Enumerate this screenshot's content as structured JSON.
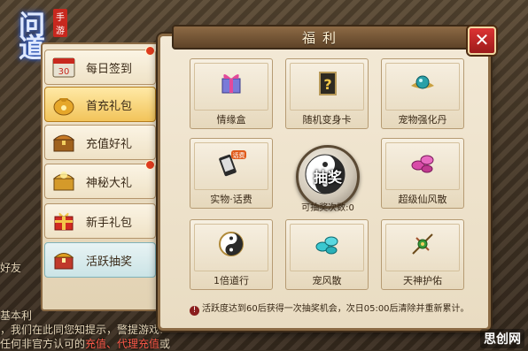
{
  "game_logo": {
    "text": "问道",
    "tag": "手游"
  },
  "dialog": {
    "title": "福利",
    "close_label": "✕"
  },
  "menu": [
    {
      "label": "每日签到",
      "icon": "calendar-icon",
      "badge": true
    },
    {
      "label": "首充礼包",
      "icon": "money-bag-icon",
      "badge": false
    },
    {
      "label": "充值好礼",
      "icon": "treasure-chest-icon",
      "badge": false
    },
    {
      "label": "神秘大礼",
      "icon": "gold-chest-icon",
      "badge": true
    },
    {
      "label": "新手礼包",
      "icon": "gift-box-icon",
      "badge": false
    },
    {
      "label": "活跃抽奖",
      "icon": "lottery-chest-icon",
      "badge": false
    }
  ],
  "rewards": [
    {
      "label": "情缘盒",
      "icon": "ribbon-box-icon"
    },
    {
      "label": "随机变身卡",
      "icon": "mystery-card-icon"
    },
    {
      "label": "宠物强化丹",
      "icon": "orb-icon"
    },
    {
      "label": "实物·话费",
      "icon": "phone-icon",
      "tag": "话费"
    },
    {
      "label": "超级仙风散",
      "icon": "pink-gems-icon"
    },
    {
      "label": "1倍道行",
      "icon": "yin-yang-icon"
    },
    {
      "label": "宠风散",
      "icon": "cyan-gems-icon"
    },
    {
      "label": "天神护佑",
      "icon": "amulet-icon"
    }
  ],
  "lottery": {
    "label": "抽奖",
    "draws_text": "可抽奖次数:0"
  },
  "notice": "活跃度达到60后获得一次抽奖机会，次日05:00后清除并重新累计。",
  "background_text": {
    "line1": "好友",
    "line2": "基本利",
    "line3": "，我们在此同您知提示，警提游戏:",
    "line4_prefix": "任何非官方认可的",
    "line4_red": "充值、代理充值",
    "line4_suffix": "或"
  },
  "watermark": "思创网",
  "colors": {
    "accent_red": "#c8281e",
    "active_item": "#f2c45a",
    "frame": "#8a6a44"
  }
}
